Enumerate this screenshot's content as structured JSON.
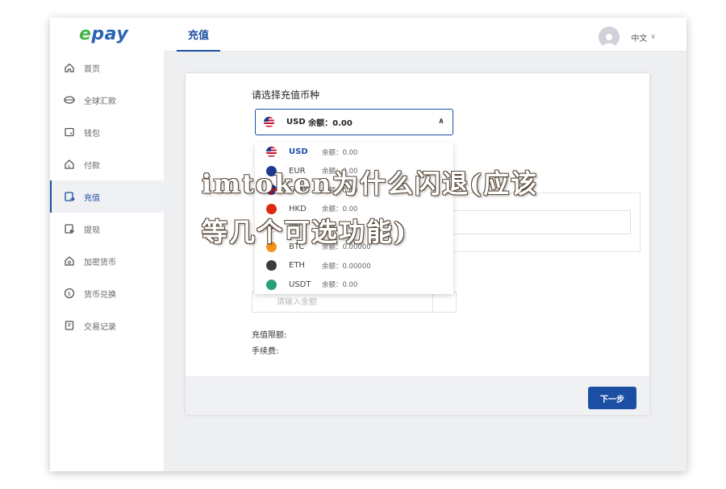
{
  "app": {
    "logo": "epay"
  },
  "sidebar": {
    "items": [
      {
        "label": "首页",
        "icon": "home-icon",
        "active": false
      },
      {
        "label": "全球汇款",
        "icon": "globe-icon",
        "active": false
      },
      {
        "label": "钱包",
        "icon": "wallet-icon",
        "active": false
      },
      {
        "label": "付款",
        "icon": "payment-icon",
        "active": false
      },
      {
        "label": "充值",
        "icon": "deposit-icon",
        "active": true
      },
      {
        "label": "提现",
        "icon": "withdraw-icon",
        "active": false
      },
      {
        "label": "加密货币",
        "icon": "crypto-icon",
        "active": false
      },
      {
        "label": "货币兑换",
        "icon": "exchange-icon",
        "active": false
      },
      {
        "label": "交易记录",
        "icon": "records-icon",
        "active": false
      }
    ]
  },
  "topbar": {
    "tab": "充值",
    "language": "中文"
  },
  "form": {
    "select_label": "请选择充值币种",
    "selected": {
      "code": "USD",
      "balance_label": "余额：0.00"
    },
    "amount_placeholder": "请输入金额",
    "limit_label": "充值限额:",
    "fee_label": "手续费:",
    "next_button": "下一步"
  },
  "currencies": [
    {
      "code": "USD",
      "balance": "余额：0.00",
      "flag": "f-usd"
    },
    {
      "code": "EUR",
      "balance": "余额：0.00",
      "flag": "f-eur"
    },
    {
      "code": "GBP",
      "balance": "余额：0.00",
      "flag": "f-gbp"
    },
    {
      "code": "HKD",
      "balance": "余额：0.00",
      "flag": "f-hkd"
    },
    {
      "code": "JPY",
      "balance": "余额：0.00",
      "flag": "f-jpy"
    },
    {
      "code": "BTC",
      "balance": "余额：0.00000",
      "flag": "f-btc"
    },
    {
      "code": "ETH",
      "balance": "余额：0.00000",
      "flag": "f-eth"
    },
    {
      "code": "USDT",
      "balance": "余额：0.00",
      "flag": "f-usdt"
    }
  ],
  "watermark": "imtoken为什么闪退(应该等几个可选功能)",
  "colors": {
    "brand": "#1c4fa3",
    "logo_accent": "#43b549"
  }
}
